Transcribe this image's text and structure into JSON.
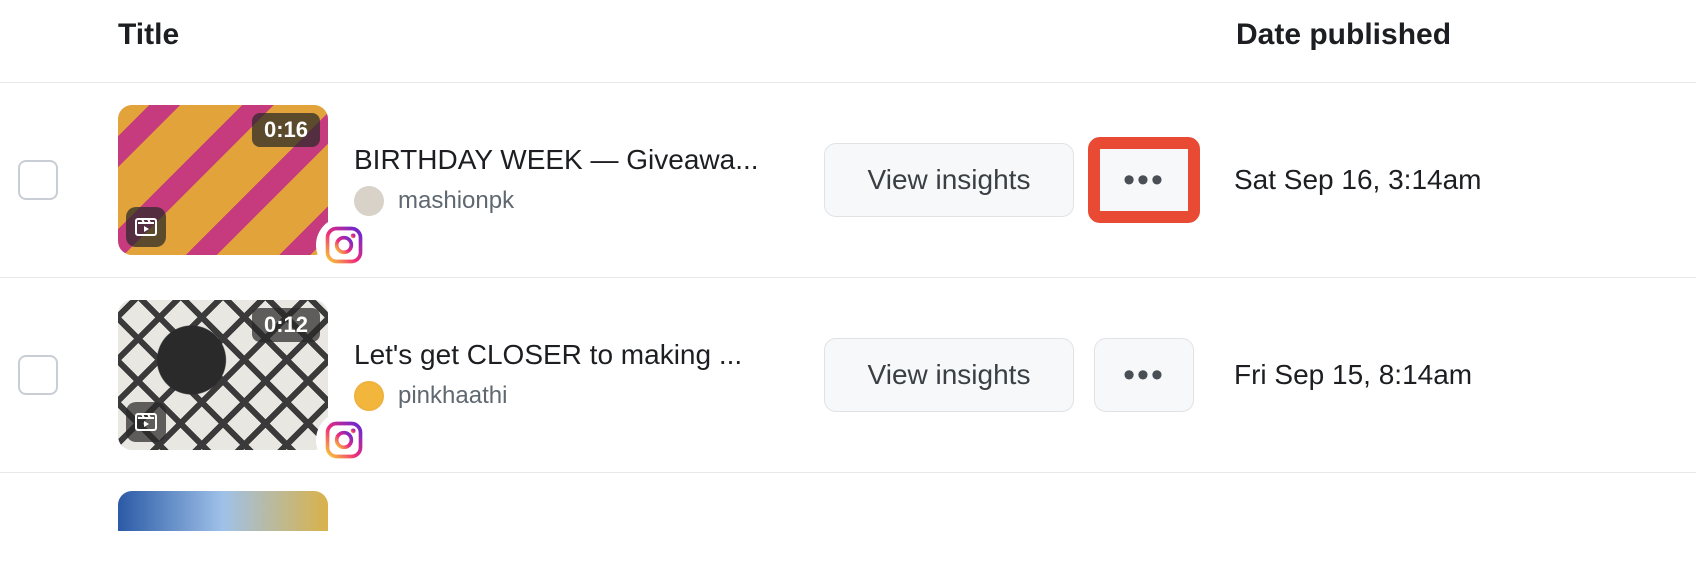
{
  "columns": {
    "title": "Title",
    "date_published": "Date published"
  },
  "actions": {
    "view_insights": "View insights",
    "more": "•••"
  },
  "rows": [
    {
      "title": "BIRTHDAY WEEK — Giveawa...",
      "account": "mashionpk",
      "duration": "0:16",
      "date": "Sat Sep 16, 3:14am",
      "thumb_style": "a",
      "avatar_style": "plain",
      "more_highlighted": true
    },
    {
      "title": "Let's get CLOSER to making ...",
      "account": "pinkhaathi",
      "duration": "0:12",
      "date": "Fri Sep 15, 8:14am",
      "thumb_style": "b",
      "avatar_style": "gold",
      "more_highlighted": false
    }
  ]
}
